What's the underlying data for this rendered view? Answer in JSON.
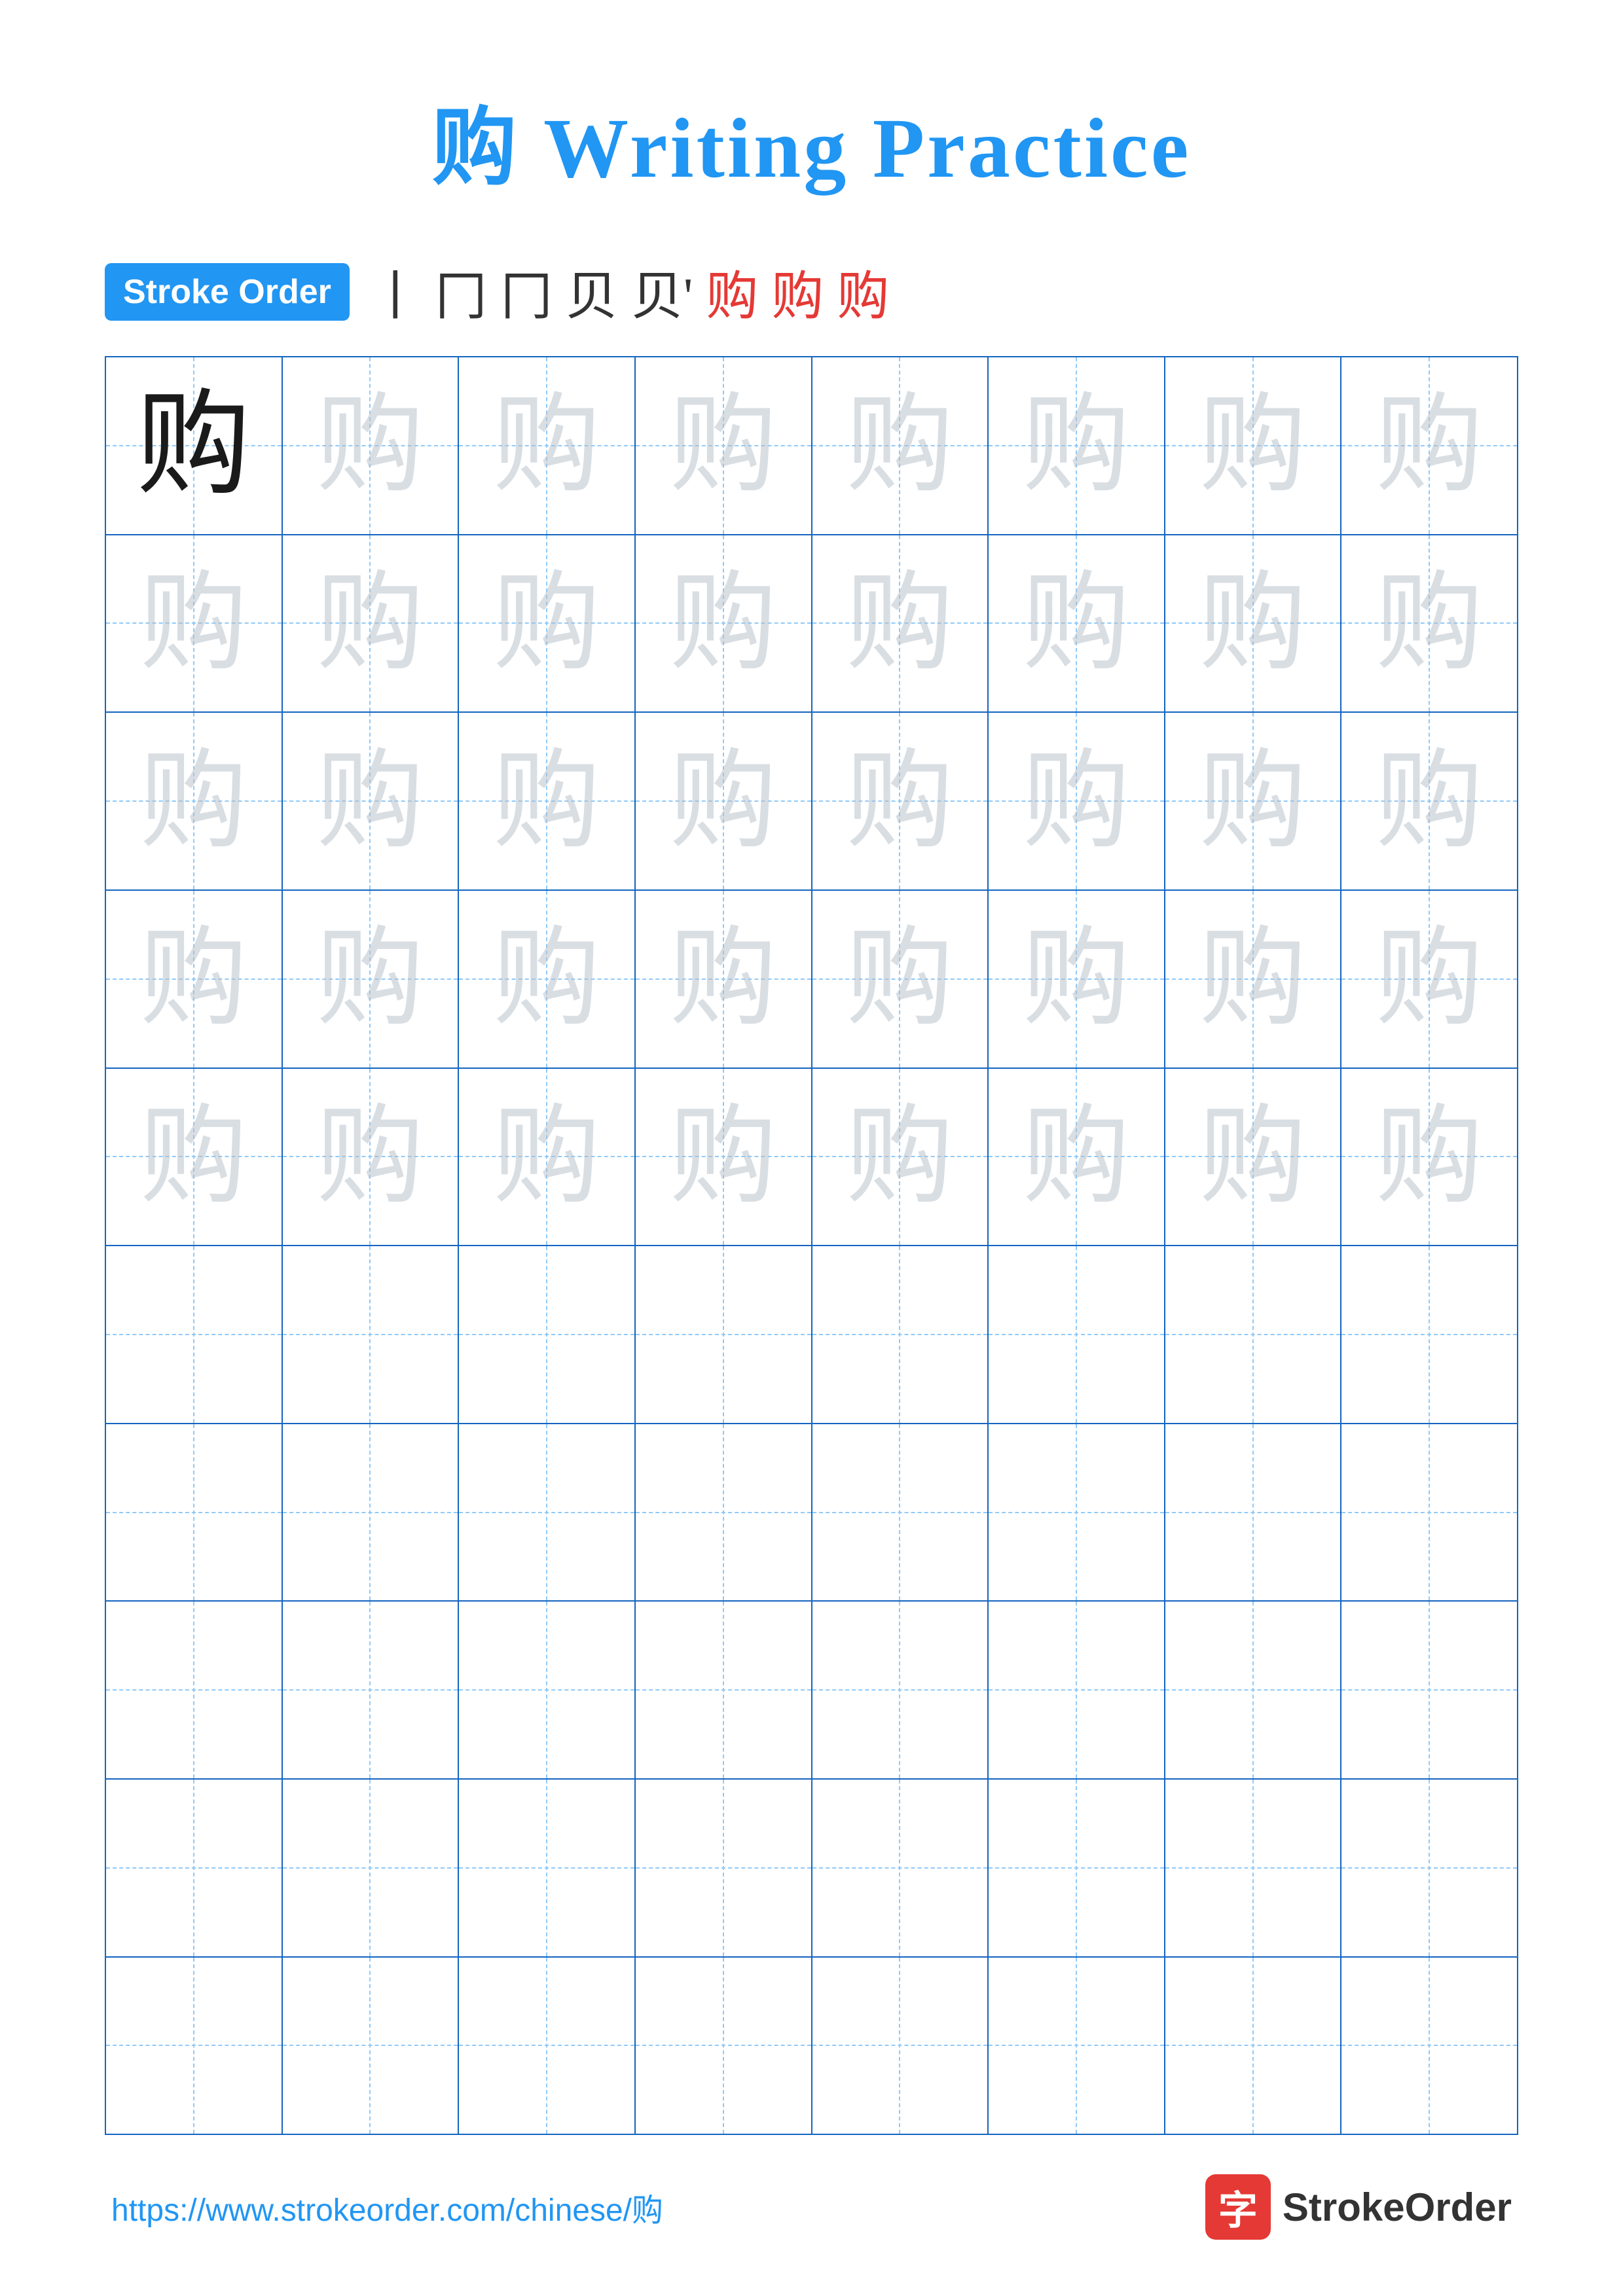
{
  "title": "购 Writing Practice",
  "stroke_order_label": "Stroke Order",
  "stroke_sequence": [
    "丨",
    "冂",
    "冂",
    "贝",
    "贝'",
    "购",
    "购",
    "购"
  ],
  "character": "购",
  "rows": 10,
  "cols": 8,
  "practice_rows_with_chars": 5,
  "footer_url": "https://www.strokeorder.com/chinese/购",
  "brand_icon": "字",
  "brand_name": "StrokeOrder"
}
